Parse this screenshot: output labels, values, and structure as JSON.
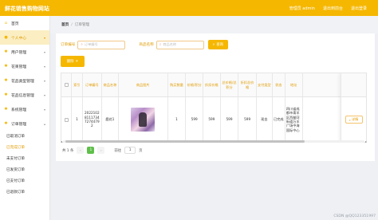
{
  "app": {
    "title": "鲜花销售购物网站",
    "welcome": "管理员 admin",
    "front_link": "退出到前台",
    "logout": "退出登录"
  },
  "sidebar": {
    "items": [
      {
        "label": "首页",
        "icon": "home-icon"
      },
      {
        "label": "个人中心",
        "icon": "person-icon"
      },
      {
        "label": "用户管理",
        "icon": "gear-icon"
      },
      {
        "label": "花束管理",
        "icon": "gear-icon"
      },
      {
        "label": "花品类型管理",
        "icon": "gear-icon"
      },
      {
        "label": "花品信息管理",
        "icon": "gear-icon"
      },
      {
        "label": "系统管理",
        "icon": "gear-icon"
      },
      {
        "label": "订单管理",
        "icon": "gear-icon"
      }
    ],
    "sub_items": [
      "已取消订单",
      "已完成订单",
      "未支付订单",
      "已发货订单",
      "已支付订单",
      "已退款订单"
    ]
  },
  "breadcrumb": {
    "home": "首页",
    "separator": "/",
    "current": "订单管理"
  },
  "search": {
    "order_label": "订单编号",
    "order_placeholder": "订单编号",
    "name_label": "商品名称",
    "name_placeholder": "商品名称",
    "button": "查询"
  },
  "delete_button": "删除",
  "table": {
    "headers": [
      "索引",
      "订单编号",
      "商品名称",
      "商品图片",
      "购买数量",
      "价格/积分",
      "折扣价格",
      "总价格/总积分",
      "折扣总价格",
      "支付类型",
      "状态",
      "地址"
    ],
    "row": {
      "index": "1",
      "order_no": "2022102811173472744792",
      "name": "鹿花1",
      "qty": "1",
      "price": "599",
      "discount": "599",
      "total": "599",
      "discount_total": "599",
      "pay_type": "现金",
      "status": "已完成",
      "address": "四川省成都市青羊区西御河街道万丰广场中海国际中心"
    },
    "detail_button": "详情"
  },
  "pager": {
    "total": "共 1 条",
    "current": "1",
    "goto_label": "前往",
    "goto_value": "1",
    "page_suffix": "页"
  },
  "watermark": "CSDN @QQ123351997",
  "colors": {
    "accent": "#f5b700",
    "accent_text": "#e09b00",
    "page_current": "#5fbf4a"
  }
}
